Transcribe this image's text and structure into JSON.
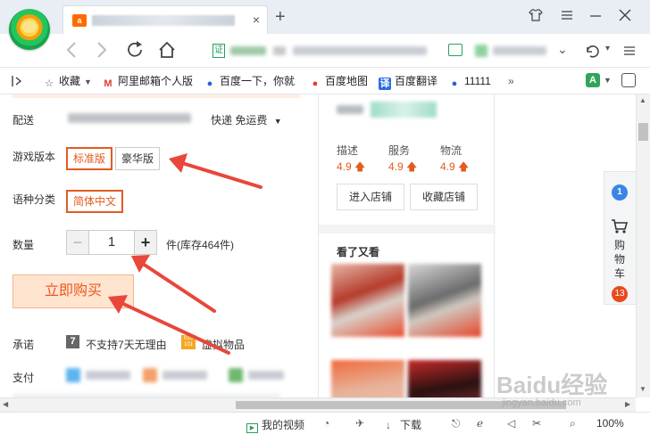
{
  "browser": {
    "tab_favicon": "a",
    "tab_close": "×",
    "new_tab": "+",
    "bookmarks": [
      {
        "label": "收藏",
        "icon": "star-icon"
      },
      {
        "label": "阿里邮箱个人版",
        "icon": "aliyun-mail-icon"
      },
      {
        "label": "百度一下，你就",
        "icon": "baidu-paw-icon"
      },
      {
        "label": "百度地图",
        "icon": "map-pin-icon"
      },
      {
        "label": "百度翻译",
        "icon": "translate-icon"
      },
      {
        "label": "11111",
        "icon": "baidu-paw-icon"
      }
    ],
    "translate_icon_text": "译",
    "mail_icon_text": "M"
  },
  "product": {
    "delivery_label": "配送",
    "delivery_method": "快递 免运费",
    "version_label": "游戏版本",
    "version_options": [
      "标准版",
      "豪华版"
    ],
    "language_label": "语种分类",
    "language_options": [
      "简体中文"
    ],
    "quantity_label": "数量",
    "quantity_value": "1",
    "quantity_minus": "−",
    "quantity_plus": "+",
    "stock_text": "件(库存464件)",
    "buy_button": "立即购买",
    "promise_label": "承诺",
    "promise_badge": "7",
    "promise_text": "不支持7天无理由",
    "virtual_badge": "010 101",
    "virtual_text": "虚拟物品",
    "payment_label": "支付"
  },
  "shop": {
    "ratings": [
      {
        "label": "描述",
        "value": "4.9"
      },
      {
        "label": "服务",
        "value": "4.9"
      },
      {
        "label": "物流",
        "value": "4.9"
      }
    ],
    "enter_shop": "进入店铺",
    "favorite_shop": "收藏店铺",
    "recommend_title": "看了又看"
  },
  "sidebar": {
    "cart_chars": [
      "购",
      "物",
      "车"
    ],
    "cart_count": "13"
  },
  "status": {
    "my_video": "我的视频",
    "download": "下载",
    "zoom": "100%"
  },
  "watermark": {
    "text": "Baidu经验",
    "url": "jingyan.baidu.com"
  },
  "colors": {
    "accent": "#e35b1f",
    "arrow": "#e8473a",
    "buy_bg": "#ffe4d0"
  }
}
